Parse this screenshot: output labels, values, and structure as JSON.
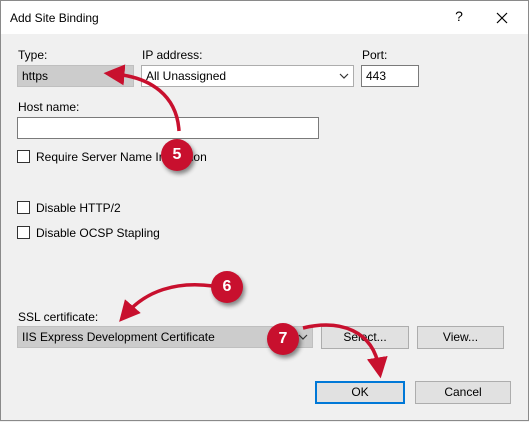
{
  "window": {
    "title": "Add Site Binding",
    "help_label": "?",
    "close_icon": "close-icon"
  },
  "type": {
    "label": "Type:",
    "value": "https"
  },
  "ip": {
    "label": "IP address:",
    "value": "All Unassigned"
  },
  "port": {
    "label": "Port:",
    "value": "443"
  },
  "host": {
    "label": "Host name:",
    "value": ""
  },
  "checkboxes": {
    "sni": "Require Server Name Indication",
    "http2": "Disable HTTP/2",
    "ocsp": "Disable OCSP Stapling"
  },
  "ssl": {
    "label": "SSL certificate:",
    "value": "IIS Express Development Certificate",
    "select_label": "Select...",
    "view_label": "View..."
  },
  "buttons": {
    "ok": "OK",
    "cancel": "Cancel"
  },
  "annotations": {
    "step5": "5",
    "step6": "6",
    "step7": "7",
    "color": "#c8102e"
  }
}
